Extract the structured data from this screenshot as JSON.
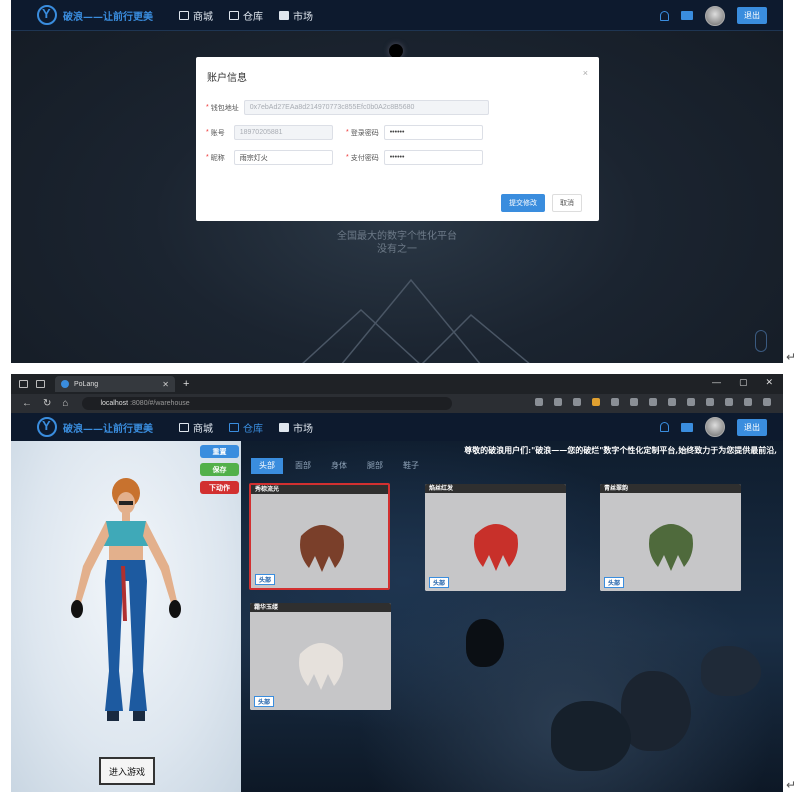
{
  "top": {
    "nav": {
      "brand": "破浪——让前行更美",
      "items": [
        "商城",
        "仓库",
        "市场"
      ],
      "active": 1,
      "logout": "退出"
    },
    "slogan": [
      "全国最大的数字个性化平台",
      "没有之一"
    ],
    "modal": {
      "title": "账户信息",
      "close": "×",
      "wallet_label": "钱包地址",
      "wallet_value": "0x7ebAd27EAa8d214970773c855Efc0b0A2c8B5680",
      "account_label": "账号",
      "account_value": "18970205881",
      "login_pw_label": "登录密码",
      "login_pw_value": "••••••",
      "nick_label": "昵称",
      "nick_value": "雨宗灯火",
      "pay_pw_label": "支付密码",
      "pay_pw_value": "••••••",
      "submit": "提交修改",
      "cancel": "取消"
    }
  },
  "bottom": {
    "browser": {
      "tab_title": "PoLang",
      "url_host": "localhost",
      "url_path": ":8080/#/warehouse"
    },
    "nav": {
      "brand": "破浪——让前行更美",
      "items": [
        "商城",
        "仓库",
        "市场"
      ],
      "active": 1,
      "logout": "退出"
    },
    "stage_buttons": [
      "重置",
      "保存",
      "下动作"
    ],
    "stage_button_colors": [
      "#3a8dde",
      "#52b04a",
      "#d23030"
    ],
    "enter_game": "进入游戏",
    "marquee": "尊敬的破浪用户们:\"破浪——您的破烂\"数字个性化定制平台,始终致力于为您提供最前沿,",
    "categories": [
      "头部",
      "面部",
      "身体",
      "腿部",
      "鞋子"
    ],
    "active_category": 0,
    "items": [
      {
        "name": "秀棕流光",
        "tag": "头部",
        "color": "#7a3f2a",
        "selected": true
      },
      {
        "name": "焰丝红发",
        "tag": "头部",
        "color": "#c8302a",
        "selected": false
      },
      {
        "name": "青丝翠韵",
        "tag": "头部",
        "color": "#4f6a3c",
        "selected": false
      },
      {
        "name": "霜华玉缕",
        "tag": "头部",
        "color": "#e6e1dc",
        "selected": false
      }
    ]
  }
}
